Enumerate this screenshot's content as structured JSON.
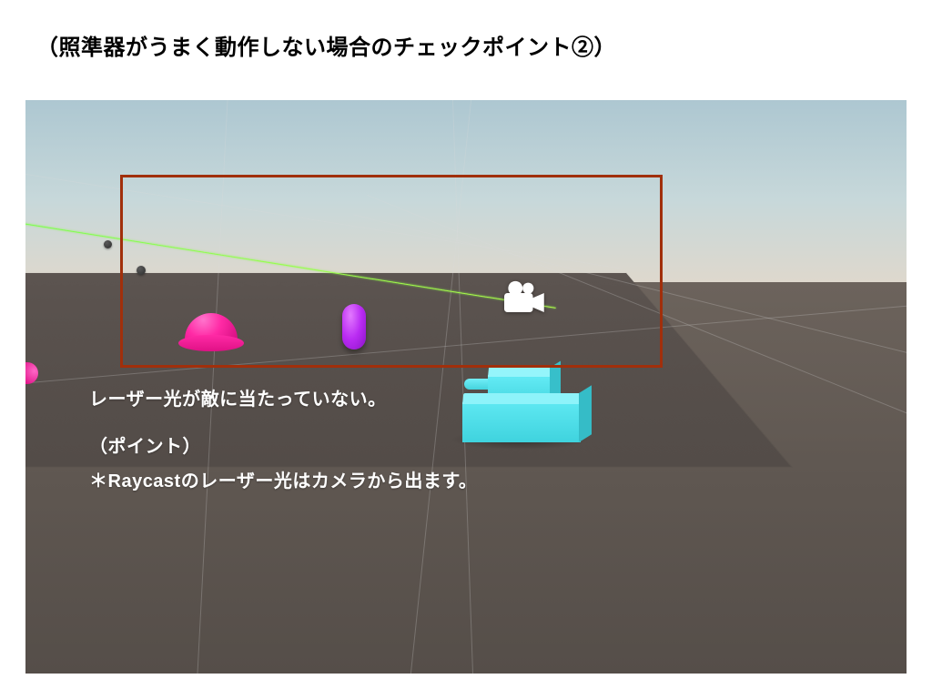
{
  "title": "（照準器がうまく動作しない場合のチェックポイント②）",
  "annotation": {
    "line1": "レーザー光が敵に当たっていない。",
    "line2": "（ポイント）",
    "line3": "＊Raycastのレーザー光はカメラから出ます。"
  },
  "icons": {
    "camera": "camera-icon"
  },
  "colors": {
    "highlight_border": "#a12f0b",
    "ray": "#8bff4a",
    "tank": "#4fd9e3",
    "dome": "#ff2aa5",
    "capsule": "#b92bf2"
  },
  "scene": {
    "engine_hint": "Unity Scene View"
  }
}
